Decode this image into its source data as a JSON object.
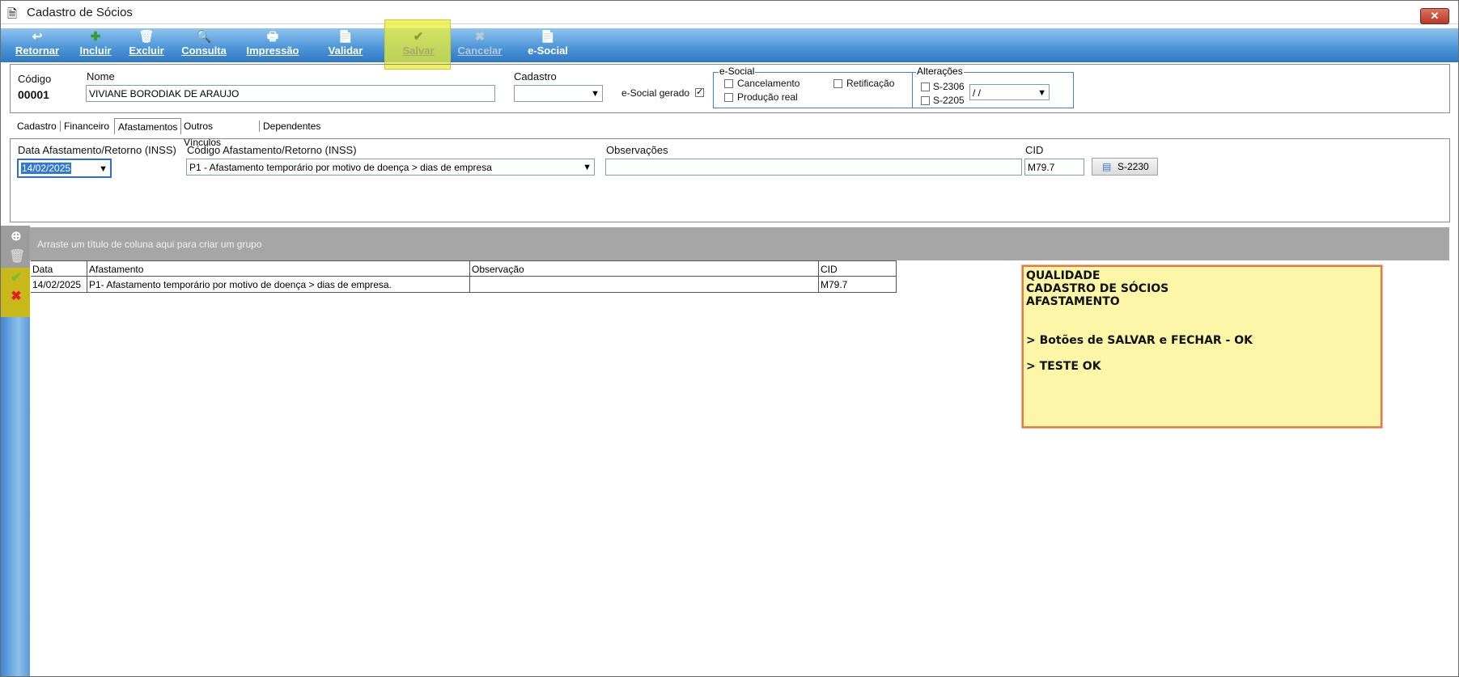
{
  "window": {
    "title": "Cadastro de Sócios",
    "close": "✕"
  },
  "toolbar": [
    {
      "label": "Retornar",
      "icon": "↩"
    },
    {
      "label": "Incluir",
      "icon": "✚"
    },
    {
      "label": "Excluir",
      "icon": "🗑"
    },
    {
      "label": "Consulta",
      "icon": "🔍"
    },
    {
      "label": "Impressão",
      "icon": "🖶"
    },
    {
      "label": "Validar",
      "icon": "📄"
    },
    {
      "label": "Salvar",
      "icon": "✔"
    },
    {
      "label": "Cancelar",
      "icon": "✖"
    },
    {
      "label": "e-Social",
      "icon": "📄"
    }
  ],
  "header": {
    "codigo_label": "Código",
    "codigo_value": "00001",
    "nome_label": "Nome",
    "nome_value": "VIVIANE BORODIAK DE ARAUJO",
    "cadastro_label": "Cadastro",
    "cadastro_value": "",
    "esocial_gerado_label": "e-Social gerado",
    "esocial_gerado_checked": true,
    "esocial_group": {
      "legend": "e-Social",
      "cancelamento": "Cancelamento",
      "retificacao": "Retificação",
      "producao_real": "Produção real"
    },
    "alteracoes_group": {
      "legend": "Alterações",
      "s2306": "S-2306",
      "s2205": "S-2205",
      "date_value": " / /"
    }
  },
  "tabs": [
    "Cadastro",
    "Financeiro",
    "Afastamentos",
    "Outros Vínculos",
    "Dependentes"
  ],
  "active_tab": "Afastamentos",
  "form": {
    "data_label": "Data Afastamento/Retorno (INSS)",
    "data_value": "14/02/2025",
    "codigo_label": "Código  Afastamento/Retorno (INSS)",
    "codigo_value": "P1 - Afastamento temporário por motivo de doença >  dias de empresa",
    "obs_label": "Observações",
    "obs_value": "",
    "cid_label": "CID",
    "cid_value": "M79.7",
    "s2230_label": "S-2230"
  },
  "grid": {
    "group_hint": "Arraste um título de coluna aqui para criar um grupo",
    "columns": [
      "Data",
      "Afastamento",
      "Observação",
      "CID"
    ],
    "rows": [
      [
        "14/02/2025",
        "P1- Afastamento temporário por motivo de doença > dias de empresa.",
        "",
        "M79.7"
      ]
    ]
  },
  "note": {
    "lines": [
      "QUALIDADE",
      "CADASTRO DE SÓCIOS",
      "AFASTAMENTO",
      "",
      "",
      "> Botões de SALVAR e FECHAR - OK",
      "",
      "> TESTE OK"
    ]
  },
  "colors": {
    "toolbar": "#4f97d8",
    "highlight": "#e9ee33",
    "note_bg": "#fdf6a6",
    "note_border": "#e07a4f"
  }
}
